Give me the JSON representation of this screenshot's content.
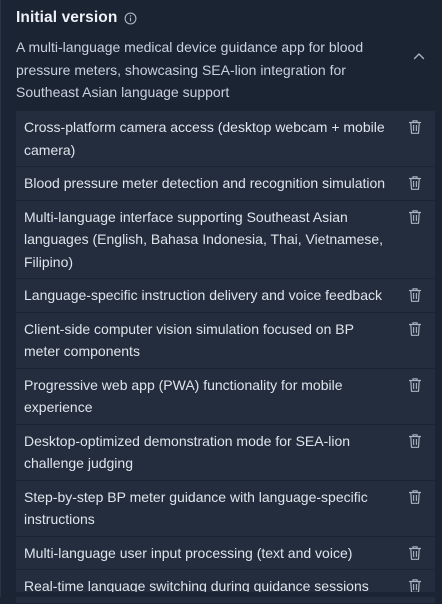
{
  "header": {
    "title": "Initial version",
    "description": "A multi-language medical device guidance app for blood pressure meters, showcasing SEA-lion integration for Southeast Asian language support"
  },
  "colors": {
    "background": "#1b2433",
    "item_background": "#232d3d",
    "text": "#dfe4eb",
    "icon": "#aab3c0"
  },
  "icons": {
    "info": "info-icon",
    "collapse": "chevron-up-icon",
    "delete": "trash-icon"
  },
  "features": [
    "Cross-platform camera access (desktop webcam + mobile camera)",
    "Blood pressure meter detection and recognition simulation",
    "Multi-language interface supporting Southeast Asian languages (English, Bahasa Indonesia, Thai, Vietnamese, Filipino)",
    "Language-specific instruction delivery and voice feedback",
    "Client-side computer vision simulation focused on BP meter components",
    "Progressive web app (PWA) functionality for mobile experience",
    "Desktop-optimized demonstration mode for SEA-lion challenge judging",
    "Step-by-step BP meter guidance with language-specific instructions",
    "Multi-language user input processing (text and voice)",
    "Real-time language switching during guidance sessions"
  ]
}
